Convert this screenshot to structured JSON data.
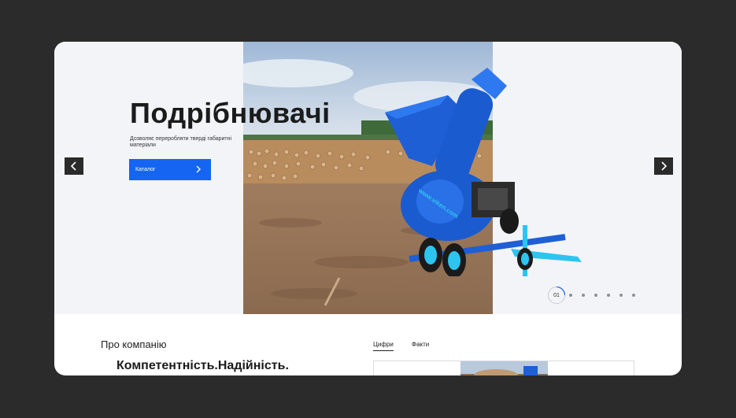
{
  "hero": {
    "title": "Подрібнювачі",
    "subtitle": "Дозволяє переробляти тверді габаритні матеріали",
    "catalog_button": "Каталог",
    "slide_indicator": "01",
    "slide_count": 7,
    "machine_logo_text": "www.viken.com"
  },
  "about": {
    "label": "Про компанію",
    "heading": "Компетентність.Надійність."
  },
  "tabs": [
    {
      "label": "Цифри",
      "active": true
    },
    {
      "label": "Факти",
      "active": false
    }
  ],
  "colors": {
    "page_background": "#2b2b2b",
    "accent": "#1565f2",
    "machine_blue": "#1e5fd6",
    "machine_cyan": "#2ec4f0",
    "hero_background": "#f3f4f8"
  },
  "icons": {
    "prev": "chevron-left-icon",
    "next": "chevron-right-icon",
    "catalog_arrow": "chevron-right-icon"
  }
}
